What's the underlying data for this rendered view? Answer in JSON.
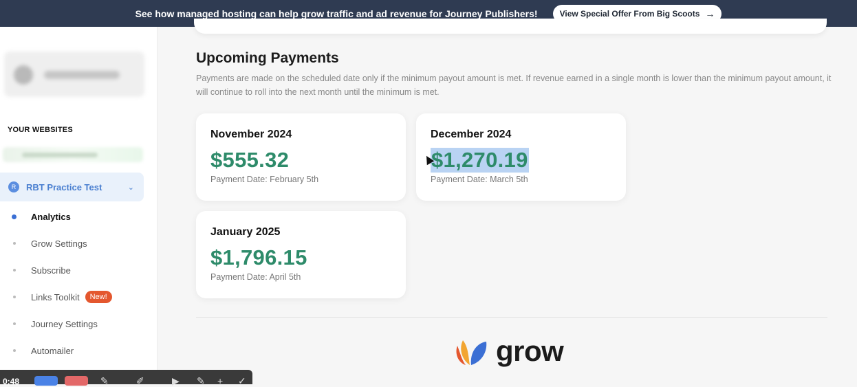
{
  "banner": {
    "message": "See how managed hosting can help grow traffic and ad revenue for Journey Publishers!",
    "cta_label": "View Special Offer From Big Scoots",
    "cta_icon": "arrow-right-icon"
  },
  "sidebar": {
    "section_title": "YOUR WEBSITES",
    "active_site": {
      "badge": "R",
      "name": "RBT Practice Test"
    },
    "nav": [
      {
        "label": "Analytics",
        "active": true
      },
      {
        "label": "Grow Settings"
      },
      {
        "label": "Subscribe"
      },
      {
        "label": "Links Toolkit",
        "badge": "New!"
      },
      {
        "label": "Journey Settings"
      },
      {
        "label": "Automailer"
      }
    ]
  },
  "main": {
    "title": "Upcoming Payments",
    "description": "Payments are made on the scheduled date only if the minimum payout amount is met. If revenue earned in a single month is lower than the minimum payout amount, it will continue to roll into the next month until the minimum is met.",
    "payments": [
      {
        "month": "November 2024",
        "amount": "$555.32",
        "date": "Payment Date: February 5th"
      },
      {
        "month": "December 2024",
        "amount": "$1,270.19",
        "date": "Payment Date: March 5th"
      },
      {
        "month": "January 2025",
        "amount": "$1,796.15",
        "date": "Payment Date: April 5th"
      }
    ],
    "logo_text": "grow"
  },
  "recorder": {
    "time": "0:48"
  },
  "colors": {
    "banner": "#2f3b52",
    "amount": "#2e8b6a",
    "accent": "#4a7fd0",
    "new_badge": "#e4572e"
  }
}
